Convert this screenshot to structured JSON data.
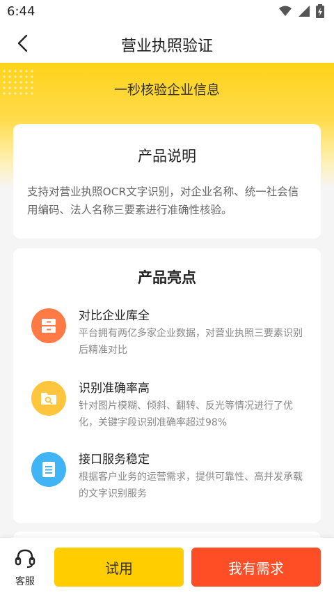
{
  "status_bar": {
    "time": "6:44",
    "icons": [
      "wifi-icon",
      "signal-icon",
      "battery-icon"
    ]
  },
  "nav": {
    "title": "营业执照验证",
    "back_icon": "chevron-left-icon"
  },
  "hero": {
    "text": "一秒核验企业信息"
  },
  "product_description": {
    "title": "产品说明",
    "text": "支持对营业执照OCR文字识别，对企业名称、统一社会信用编码、法人名称三要素进行准确性核验。"
  },
  "highlights": {
    "title": "产品亮点",
    "items": [
      {
        "title": "对比企业库全",
        "desc": "平台拥有两亿多家企业数据，对营业执照三要素识别后精准对比",
        "icon": "database-icon",
        "color": "#ff7a45"
      },
      {
        "title": "识别准确率高",
        "desc": "针对图片模糊、倾斜、翻转、反光等情况进行了优化，关键字段识别准确率超过98%",
        "icon": "folder-search-icon",
        "color": "#ffc53d"
      },
      {
        "title": "接口服务稳定",
        "desc": "根据客户业务的运营需求，提供可靠性、高并发承载的文字识别服务",
        "icon": "server-icon",
        "color": "#40b4f5"
      }
    ]
  },
  "bottom_bar": {
    "service_label": "客服",
    "trial_label": "试用",
    "demand_label": "我有需求"
  },
  "colors": {
    "accent_yellow": "#ffcd00",
    "accent_red": "#ff4d26"
  }
}
